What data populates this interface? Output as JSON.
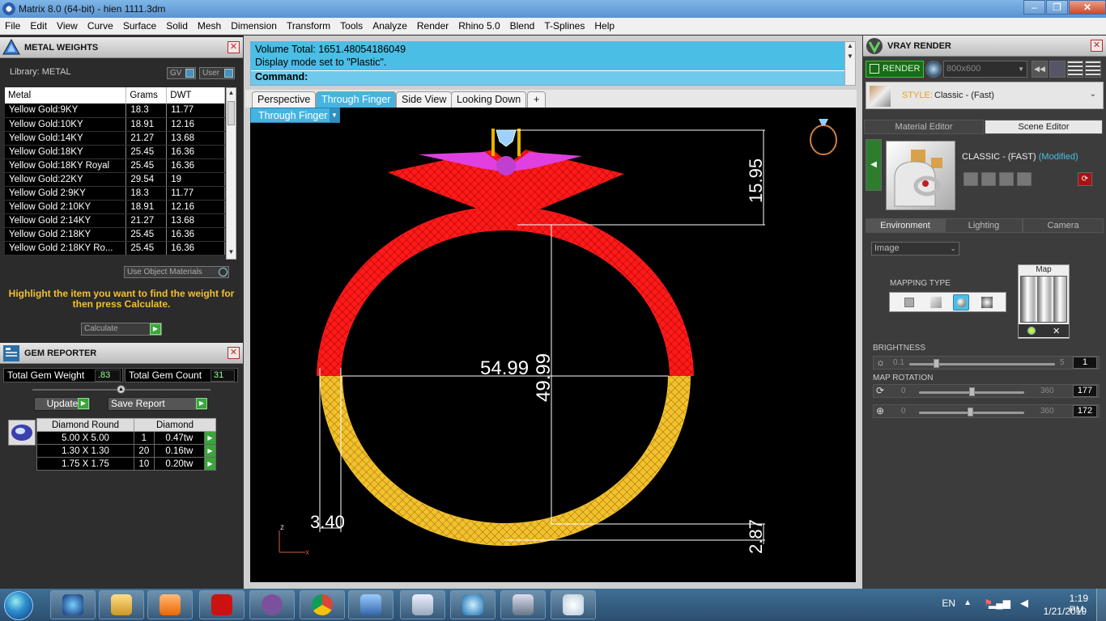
{
  "window": {
    "title": "Matrix 8.0 (64-bit) - hien 1111.3dm",
    "min": "–",
    "max": "❐",
    "close": "✕"
  },
  "menu": [
    "File",
    "Edit",
    "View",
    "Curve",
    "Surface",
    "Solid",
    "Mesh",
    "Dimension",
    "Transform",
    "Tools",
    "Analyze",
    "Render",
    "Rhino 5.0",
    "Blend",
    "T-Splines",
    "Help"
  ],
  "metal_panel": {
    "title": "METAL WEIGHTS",
    "library": "Library: METAL",
    "gv": "GV",
    "user": "User",
    "headers": [
      "Metal",
      "Grams",
      "DWT"
    ],
    "rows": [
      [
        "Yellow Gold:9KY",
        "18.3",
        "11.77"
      ],
      [
        "Yellow Gold:10KY",
        "18.91",
        "12.16"
      ],
      [
        "Yellow Gold:14KY",
        "21.27",
        "13.68"
      ],
      [
        "Yellow Gold:18KY",
        "25.45",
        "16.36"
      ],
      [
        "Yellow Gold:18KY Royal",
        "25.45",
        "16.36"
      ],
      [
        "Yellow Gold:22KY",
        "29.54",
        "19"
      ],
      [
        "Yellow Gold 2:9KY",
        "18.3",
        "11.77"
      ],
      [
        "Yellow Gold 2:10KY",
        "18.91",
        "12.16"
      ],
      [
        "Yellow Gold 2:14KY",
        "21.27",
        "13.68"
      ],
      [
        "Yellow Gold 2:18KY",
        "25.45",
        "16.36"
      ],
      [
        "Yellow Gold 2:18KY Ro...",
        "25.45",
        "16.36"
      ]
    ],
    "use_object": "Use Object Materials",
    "hint": "Highlight the item you want to find the weight for then press Calculate.",
    "calculate": "Calculate"
  },
  "gem_panel": {
    "title": "GEM REPORTER",
    "total_weight_label": "Total Gem Weight",
    "total_weight": ".83",
    "total_count_label": "Total Gem Count",
    "total_count": "31",
    "update": "Update",
    "save_report": "Save Report",
    "headers": [
      "Diamond Round",
      "Diamond"
    ],
    "rows": [
      [
        "5.00 X 5.00",
        "1",
        "0.47tw"
      ],
      [
        "1.30 X 1.30",
        "20",
        "0.16tw"
      ],
      [
        "1.75 X 1.75",
        "10",
        "0.20tw"
      ]
    ]
  },
  "command": {
    "line1": "Volume Total: 1651.48054186049",
    "line2": "Display mode set to \"Plastic\".",
    "prompt": "Command:"
  },
  "viewport": {
    "tabs": [
      "Perspective",
      "Through Finger",
      "Side View",
      "Looking Down",
      "+"
    ],
    "active_tab": "Through Finger",
    "dropdown": "Through Finger",
    "dims": {
      "top": "15.95",
      "width": "54.99",
      "height": "49.99",
      "left": "3.40",
      "right": "2.87"
    },
    "axis_z": "z",
    "axis_x": "x"
  },
  "vray": {
    "title": "VRAY RENDER",
    "render": "RENDER",
    "resolution": "800x600",
    "style_label": "STYLE:",
    "style_value": "Classic - (Fast)",
    "tab_material": "Material Editor",
    "tab_scene": "Scene Editor",
    "preset_name": "CLASSIC - (FAST)",
    "preset_mod": "(Modified)",
    "sub_tabs": [
      "Environment",
      "Lighting",
      "Camera"
    ],
    "env_select": "Image",
    "mapping_type": "MAPPING TYPE",
    "map_label": "Map",
    "brightness_label": "BRIGHTNESS",
    "brightness_min": "0.1",
    "brightness_max": "5",
    "brightness_val": "1",
    "map_rotation_label": "MAP ROTATION",
    "rot_min": "0",
    "rot_max": "360",
    "rot1_val": "177",
    "rot2_val": "172"
  },
  "taskbar": {
    "lang": "EN",
    "time": "1:19 PM",
    "date": "1/21/2019"
  },
  "colors": {
    "accent": "#45b4e0",
    "ring_red": "#ff1a1a",
    "ring_gold": "#f2c12e",
    "ring_magenta": "#e040e0"
  }
}
